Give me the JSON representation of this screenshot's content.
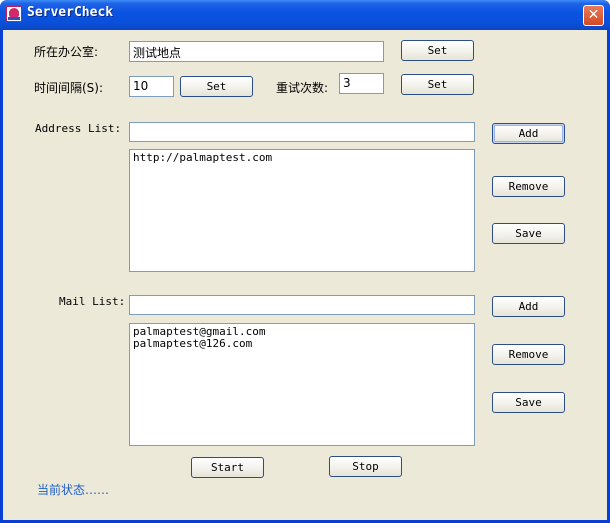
{
  "window": {
    "title": "ServerCheck",
    "close_glyph": "✕"
  },
  "office": {
    "label": "所在办公室:",
    "value": "测试地点",
    "set_label": "Set"
  },
  "interval": {
    "label": "时间间隔(S):",
    "value": "10",
    "set_label": "Set"
  },
  "retry": {
    "label": "重试次数:",
    "value": "3",
    "set_label": "Set"
  },
  "address": {
    "label": "Address List:",
    "input_value": "",
    "items": [
      "http://palmaptest.com"
    ],
    "add_label": "Add",
    "remove_label": "Remove",
    "save_label": "Save"
  },
  "mail": {
    "label": "Mail List:",
    "input_value": "",
    "items": [
      "palmaptest@gmail.com",
      "palmaptest@126.com"
    ],
    "add_label": "Add",
    "remove_label": "Remove",
    "save_label": "Save"
  },
  "controls": {
    "start_label": "Start",
    "stop_label": "Stop"
  },
  "status": {
    "text": "当前状态……"
  },
  "colors": {
    "titlebar": "#0a54e3",
    "client": "#ece9d8",
    "status_text": "#1f5fc8"
  }
}
